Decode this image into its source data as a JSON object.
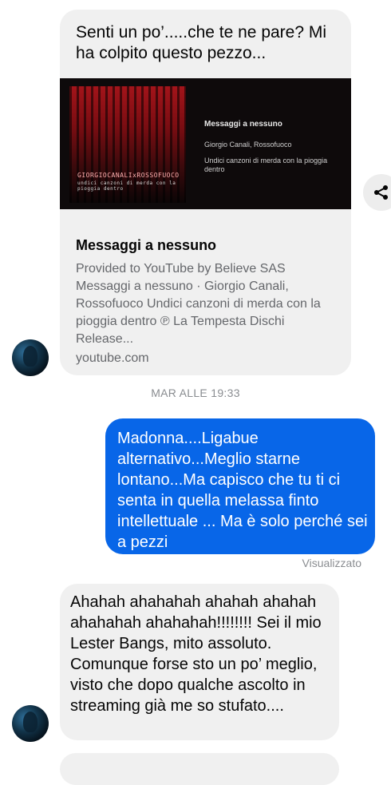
{
  "messages": {
    "shared_link": {
      "caption": "Senti un po’.....che te ne pare? Mi ha colpito questo pezzo...",
      "thumbnail": {
        "album_cover_text": "GIORGIOCANALIxROSSOFUOCO",
        "album_cover_subtext": "undici canzoni di merda con la pioggia dentro",
        "title": "Messaggi a nessuno",
        "artist": "Giorgio Canali, Rossofuoco",
        "album": "Undici canzoni di merda con la pioggia dentro"
      },
      "title": "Messaggi a nessuno",
      "description": "Provided to YouTube by Believe SAS Messaggi a nessuno · Giorgio Canali, Rossofuoco Undici canzoni di merda con la pioggia dentro ℗ La Tempesta Dischi Release...",
      "domain": "youtube.com"
    },
    "timestamp": "MAR ALLE 19:33",
    "outgoing": {
      "text": "Madonna....Ligabue alternativo...Meglio starne lontano...Ma capisco che tu ti ci senta in quella melassa finto intellettuale ... Ma è solo perché sei a pezzi",
      "status": "Visualizzato"
    },
    "incoming_reply": {
      "text": "Ahahah ahahahah ahahah ahahah ahahahah ahahahah!!!!!!!! Sei il mio Lester Bangs, mito assoluto. Comunque forse sto un po’ meglio, visto che dopo qualche ascolto in streaming già me so stufato...."
    }
  },
  "icons": {
    "share": "share-icon"
  },
  "colors": {
    "outgoing_bubble": "#0866e8",
    "incoming_bubble": "#f0f0f0",
    "meta_text": "#8a8d91"
  }
}
